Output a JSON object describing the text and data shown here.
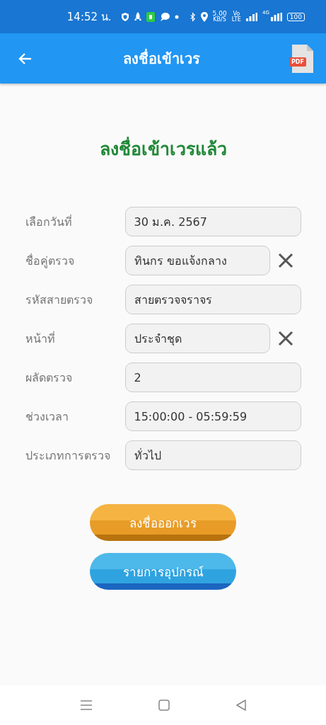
{
  "status_bar": {
    "time": "14:52 น.",
    "speed": "5.00",
    "speed_unit": "KB/S",
    "volte_top": "Vo",
    "volte_bottom": "LTE",
    "network": "4G",
    "battery": "100"
  },
  "app_bar": {
    "title": "ลงชื่อเข้าเวร"
  },
  "heading": "ลงชื่อเข้าเวรแล้ว",
  "fields": [
    {
      "label": "เลือกวันที่",
      "value": "30 ม.ค. 2567",
      "clearable": false
    },
    {
      "label": "ชื่อคู่ตรวจ",
      "value": "ทินกร ขอแจ้งกลาง",
      "clearable": true
    },
    {
      "label": "รหัสสายตรวจ",
      "value": "สายตรวจจราจร",
      "clearable": false
    },
    {
      "label": "หน้าที่",
      "value": "ประจำชุด",
      "clearable": true
    },
    {
      "label": "ผลัดตรวจ",
      "value": "2",
      "clearable": false
    },
    {
      "label": "ช่วงเวลา",
      "value": "15:00:00 - 05:59:59",
      "clearable": false
    },
    {
      "label": "ประเภทการตรวจ",
      "value": "ทั่วไป",
      "clearable": false
    }
  ],
  "buttons": [
    {
      "label": "ลงชื่อออกเวร",
      "kind": "orange"
    },
    {
      "label": "รายการอุปกรณ์",
      "kind": "blue"
    }
  ],
  "pdf_badge": "PDF"
}
